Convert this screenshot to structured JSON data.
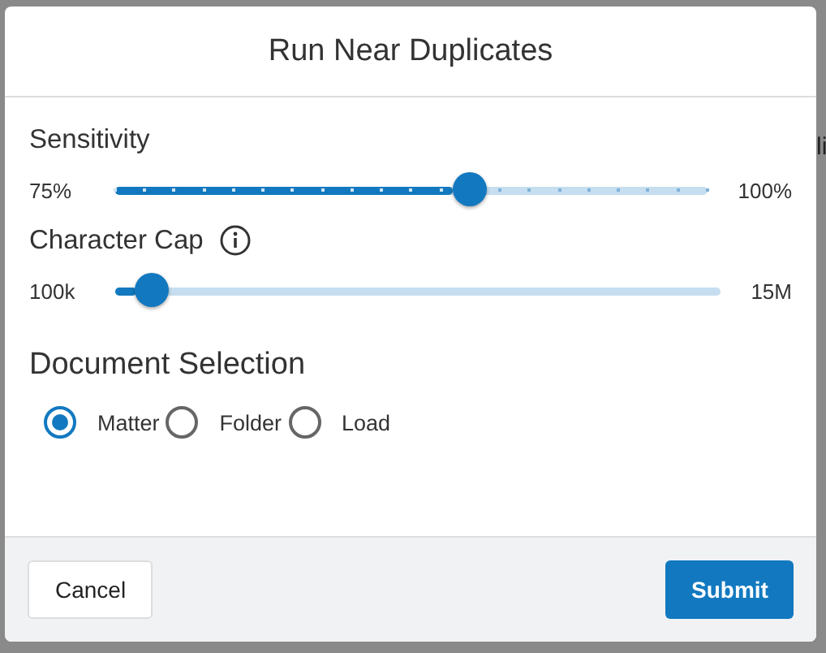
{
  "background": {
    "text": "li"
  },
  "dialog": {
    "title": "Run Near Duplicates",
    "sliders": [
      {
        "label": "Sensitivity",
        "kind": "stepped",
        "info": false,
        "min_label": "75%",
        "max_label": "100%",
        "level": 0.6
      },
      {
        "label": "Character Cap",
        "kind": "continuous",
        "info": true,
        "min_label": "100k",
        "max_label": "15M",
        "level": 0.065
      }
    ],
    "document_selection": {
      "heading": "Document Selection",
      "options": [
        {
          "label": "Matter",
          "selected": true
        },
        {
          "label": "Folder",
          "selected": false
        },
        {
          "label": "Load",
          "selected": false
        }
      ]
    },
    "buttons": [
      {
        "label": "Cancel",
        "kind": "secondary"
      },
      {
        "label": "Submit",
        "kind": "primary"
      }
    ]
  }
}
